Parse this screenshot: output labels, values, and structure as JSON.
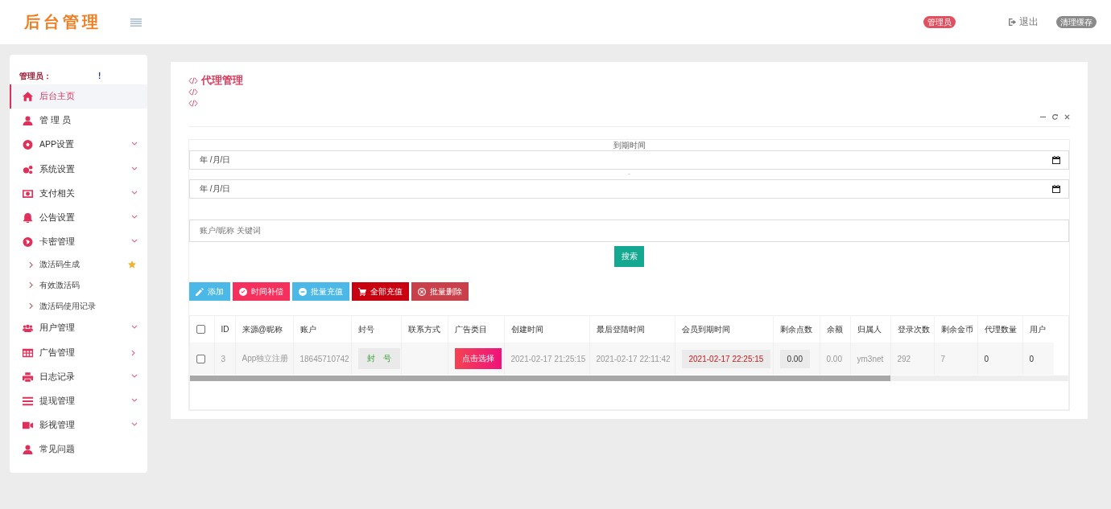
{
  "header": {
    "logo": "后台管理",
    "role_badge": "管理员",
    "logout": "退出",
    "clear_cache": "清理缓存"
  },
  "sidebar": {
    "greeting": "管理员：",
    "greeting_end": "!",
    "items": [
      {
        "label": "后台主页",
        "selected": true,
        "collapsible": false
      },
      {
        "label": "管 理 员",
        "selected": false,
        "collapsible": false
      },
      {
        "label": "APP设置",
        "selected": false,
        "collapsible": true,
        "expanded": true
      },
      {
        "label": "系统设置",
        "selected": false,
        "collapsible": true,
        "expanded": true
      },
      {
        "label": "支付相关",
        "selected": false,
        "collapsible": true,
        "expanded": true
      },
      {
        "label": "公告设置",
        "selected": false,
        "collapsible": true,
        "expanded": true
      },
      {
        "label": "卡密管理",
        "selected": false,
        "collapsible": true,
        "expanded": true,
        "children": [
          {
            "label": "激活码生成",
            "starred": true
          },
          {
            "label": "有效激活码",
            "starred": false
          },
          {
            "label": "激活码使用记录",
            "starred": false
          }
        ]
      },
      {
        "label": "用户管理",
        "selected": false,
        "collapsible": true,
        "expanded": true
      },
      {
        "label": "广告管理",
        "selected": false,
        "collapsible": true,
        "expanded": false
      },
      {
        "label": "日志记录",
        "selected": false,
        "collapsible": true,
        "expanded": true
      },
      {
        "label": "提现管理",
        "selected": false,
        "collapsible": true,
        "expanded": true
      },
      {
        "label": "影视管理",
        "selected": false,
        "collapsible": true,
        "expanded": true
      },
      {
        "label": "常见问题",
        "selected": false,
        "collapsible": false
      }
    ]
  },
  "panel": {
    "title": "代理管理",
    "filter": {
      "label": "到期时间",
      "start_placeholder": "年 /月/日",
      "separator": "-",
      "end_placeholder": "年 /月/日",
      "keyword_placeholder": "账户/昵称 关键词",
      "search": "搜索"
    },
    "actions": [
      {
        "label": "添加",
        "color": "#4bb8e8"
      },
      {
        "label": "时间补偿",
        "color": "#f5305c"
      },
      {
        "label": "批量充值",
        "color": "#4bb8e8"
      },
      {
        "label": "全部充值",
        "color": "#c8000f"
      },
      {
        "label": "批量删除",
        "color": "#c9404a"
      }
    ],
    "table": {
      "columns": [
        {
          "kind": "checkbox",
          "checked": false
        },
        {
          "kind": "text",
          "label": "ID"
        },
        {
          "kind": "text",
          "label": "来源@昵称"
        },
        {
          "kind": "text",
          "label": "账户"
        },
        {
          "kind": "text",
          "label": "封号"
        },
        {
          "kind": "text",
          "label": "联系方式"
        },
        {
          "kind": "text",
          "label": "广告类目"
        },
        {
          "kind": "text",
          "label": "创建时间"
        },
        {
          "kind": "text",
          "label": "最后登陆时间"
        },
        {
          "kind": "text",
          "label": "会员到期时间"
        },
        {
          "kind": "text",
          "label": "剩余点数"
        },
        {
          "kind": "text",
          "label": "余额"
        },
        {
          "kind": "text",
          "label": "归属人"
        },
        {
          "kind": "text",
          "label": "登录次数"
        },
        {
          "kind": "text",
          "label": "剩余金币"
        },
        {
          "kind": "text",
          "label": "代理数量"
        },
        {
          "kind": "text",
          "label": "用户"
        }
      ],
      "rows": [
        {
          "cells": [
            {
              "kind": "checkbox",
              "checked": false
            },
            {
              "kind": "text",
              "text": "3"
            },
            {
              "kind": "text",
              "text": "App独立注册"
            },
            {
              "kind": "text",
              "text": "18645710742"
            },
            {
              "kind": "tag",
              "text": "封　号"
            },
            {
              "kind": "empty"
            },
            {
              "kind": "button",
              "text": "点击选择"
            },
            {
              "kind": "text",
              "text": "2021-02-17 21:25:15"
            },
            {
              "kind": "text",
              "text": "2021-02-17 22:11:42"
            },
            {
              "kind": "date",
              "text": "2021-02-17 22:25:15"
            },
            {
              "kind": "value",
              "text": "0.00"
            },
            {
              "kind": "text",
              "text": "0.00"
            },
            {
              "kind": "text",
              "text": "ym3net"
            },
            {
              "kind": "text",
              "text": "292"
            },
            {
              "kind": "text",
              "text": "7"
            },
            {
              "kind": "dark",
              "text": "0"
            },
            {
              "kind": "dark",
              "text": "0"
            }
          ]
        }
      ]
    }
  }
}
